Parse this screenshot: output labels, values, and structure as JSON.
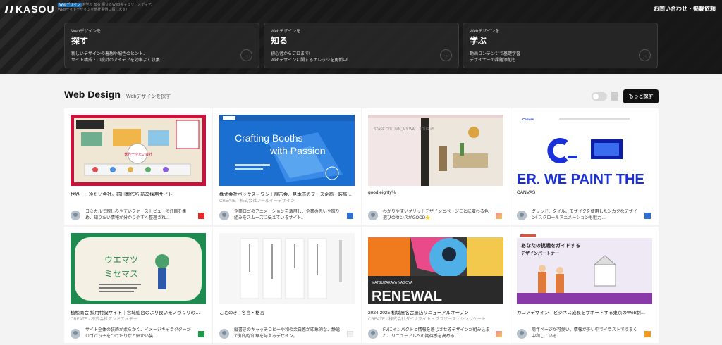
{
  "header": {
    "logo": "KASOU",
    "tagline_highlight": "Webデザイン",
    "tagline_line1": "を学ぶ 知る 探せるWEBギャラリーメディア。",
    "tagline_line2": "WEBサイトデザインを他社事例に探します！",
    "contact_link": "お問い合わせ・掲載依頼"
  },
  "hero_cards": [
    {
      "kicker": "Webデザインを",
      "title": "探す",
      "desc1": "新しいデザインの着想や配色のヒント、",
      "desc2": "サイト構成・UI設計のアイデアを効率よく収集！"
    },
    {
      "kicker": "Webデザインを",
      "title": "知る",
      "desc1": "初心者からプロまで!",
      "desc2": "Webデザインに関するナレッジを更新中!"
    },
    {
      "kicker": "Webデザインを",
      "title": "学ぶ",
      "desc1": "動画コンテンツで基礎学習",
      "desc2": "デザイナーの課題添削も"
    }
  ],
  "arrow_icon": "→",
  "main": {
    "title": "Web Design",
    "subtitle": "Webデザインを探す",
    "more_button": "もっと探す"
  },
  "cards": [
    {
      "title": "世界一、冷たい会社。前川製作所 新卒採用サイト",
      "credit": "",
      "desc": "コミカルで親しみやすいファーストビューで注目を集め、知りたい情報が分かりやすく整理され…",
      "swatch": "#e02a2a"
    },
    {
      "title": "株式会社ボックス・ワン｜展示会、見本市のブース企画・装飾…",
      "credit": "CREATE - 株式会社アールイーデザイン",
      "desc": "企業ロゴのアニメーションを活用し、企業の思いや取り組みをスムーズに伝えているサイト。",
      "swatch": "#2f6fd6"
    },
    {
      "title": "good eighty%",
      "credit": "",
      "desc": "わかりやすいグリッドデザインとページごとに変わる色選びのセンスがGOOD⭐",
      "swatch": "#e98aa8"
    },
    {
      "title": "CANVAS",
      "credit": "",
      "desc": "グリッド、タイル、モザイクを使用したシカクなデザイン! スクロールアニメーションも魅力…",
      "swatch": "#2f6fd6"
    },
    {
      "title": "植松商会 採用特設サイト｜宮城仙台のより良いモノづくりの…",
      "credit": "CREATE - 株式会社アンドエイチー",
      "desc": "サイト全体の装飾が柔らかく、イメージキャラクターがロゴパッチをつけたりなど細かい装…",
      "swatch": "#1e9a4a"
    },
    {
      "title": "ことのき - 名言・格言",
      "credit": "",
      "desc": "縦書きのキャッチコピーや和の余白感が印象的な、静謐で知的な印象を与えるデザイン。",
      "swatch": "#f2f2f2"
    },
    {
      "title": "2024-2025 松坂屋名古屋店リニューアルオープン",
      "credit": "CREATE - 株式会社ダイナマイト・ブラザーズ・シンジケート",
      "desc": "FVにインパクトと情報を感じさせるデザインが組み込まれ、リニューアルへの期待感を高める…",
      "swatch": "#e98aa8"
    },
    {
      "title": "カロアデザイン｜ビジネス成長をサポートする東京のWeb制…",
      "credit": "",
      "desc": "周年ページが可愛い。情報が多い中でイラストでうまく中和している",
      "swatch": "#f29a1e"
    }
  ],
  "thumb_texts": {
    "boxone_headline1": "Crafting Booths",
    "boxone_headline2": "with Passion",
    "good80_text": "STAFF COLUMN_MY WALL TOUR #5",
    "canvas_brand": "Canvas",
    "canvas_text": "ER. WE PAINT THE",
    "uematsu_title1": "ウエマツ",
    "uematsu_title2": "ミセマス",
    "matsuzakaya_sub": "MATSUZAKAYA NAGOYA",
    "matsuzakaya_title": "RENEWAL",
    "caroa_text1": "あなたの挑戦をガイドする",
    "caroa_text2": "デザインパートナー",
    "maekawa_text": "世界一冷たい会社"
  }
}
